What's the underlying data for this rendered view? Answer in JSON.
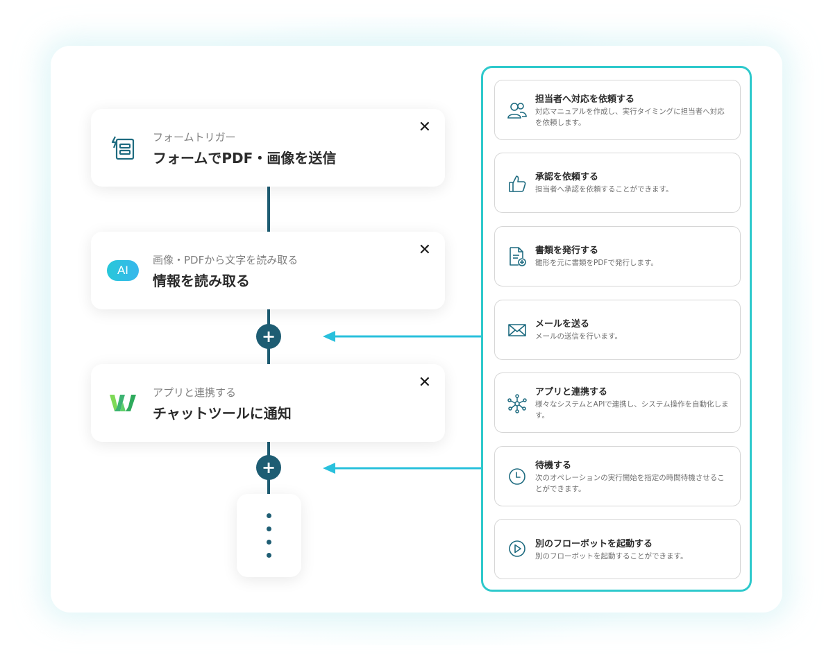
{
  "steps": [
    {
      "subtitle": "フォームトリガー",
      "title": "フォームでPDF・画像を送信",
      "close": "✕"
    },
    {
      "subtitle": "画像・PDFから文字を読み取る",
      "title": "情報を読み取る",
      "close": "✕",
      "badge": "AI"
    },
    {
      "subtitle": "アプリと連携する",
      "title": "チャットツールに通知",
      "close": "✕"
    }
  ],
  "add_symbol": "+",
  "actions": [
    {
      "title": "担当者へ対応を依頼する",
      "desc": "対応マニュアルを作成し、実行タイミングに担当者へ対応を依頼します。",
      "icon": "people-icon"
    },
    {
      "title": "承認を依頼する",
      "desc": "担当者へ承認を依頼することができます。",
      "icon": "thumbs-up-icon"
    },
    {
      "title": "書類を発行する",
      "desc": "雛形を元に書類をPDFで発行します。",
      "icon": "document-add-icon"
    },
    {
      "title": "メールを送る",
      "desc": "メールの送信を行います。",
      "icon": "mail-icon"
    },
    {
      "title": "アプリと連携する",
      "desc": "様々なシステムとAPIで連携し、システム操作を自動化します。",
      "icon": "network-icon"
    },
    {
      "title": "待機する",
      "desc": "次のオペレーションの実行開始を指定の時間待機させることができます。",
      "icon": "clock-icon"
    },
    {
      "title": "別のフローボットを起動する",
      "desc": "別のフローボットを起動することができます。",
      "icon": "play-circle-icon"
    }
  ],
  "colors": {
    "accent": "#2ec9cc",
    "flow": "#1e5d73",
    "arrow": "#29c0dc",
    "icon": "#1e6b80"
  }
}
